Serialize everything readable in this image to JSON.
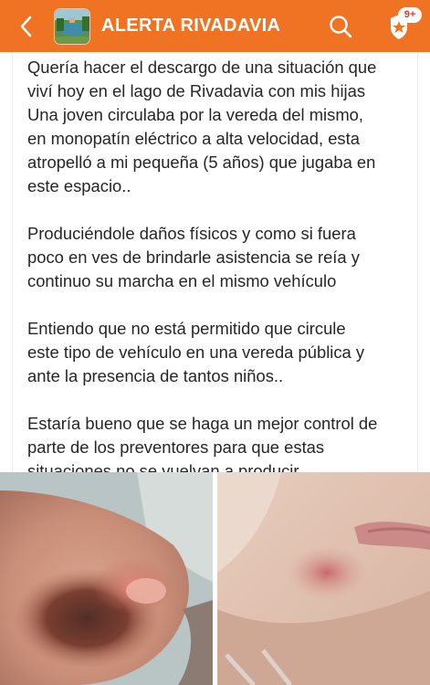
{
  "header": {
    "group_name": "ALERTA RIVADAVIA",
    "notifications_badge": "9+",
    "icons": {
      "back": "chevron-left-icon",
      "search": "search-icon",
      "notifications": "shield-icon"
    },
    "colors": {
      "accent": "#ef7323",
      "badge_text": "#e33a2a"
    }
  },
  "post": {
    "paragraphs": [
      "Quería hacer el descargo de una situación que\nviví  hoy en el lago de Rivadavia con mis hijas\nUna joven circulaba por la vereda del mismo,\nen monopatín eléctrico a alta velocidad, esta\natropelló a mi pequeña (5 años) que jugaba en\neste espacio..",
      "Produciéndole daños físicos y como si fuera\npoco en ves de brindarle asistencia se reía y\ncontinuo su marcha en el mismo vehículo",
      "Entiendo que no está permitido que circule\neste tipo de vehículo en una vereda pública y\nante la presencia de tantos niños..",
      "Estaría bueno que se haga un mejor control de\nparte de los preventores para que estas\nsituaciones no se vuelvan a producir.."
    ],
    "photos": [
      "injured-elbow-photo",
      "injured-chin-photo"
    ]
  }
}
